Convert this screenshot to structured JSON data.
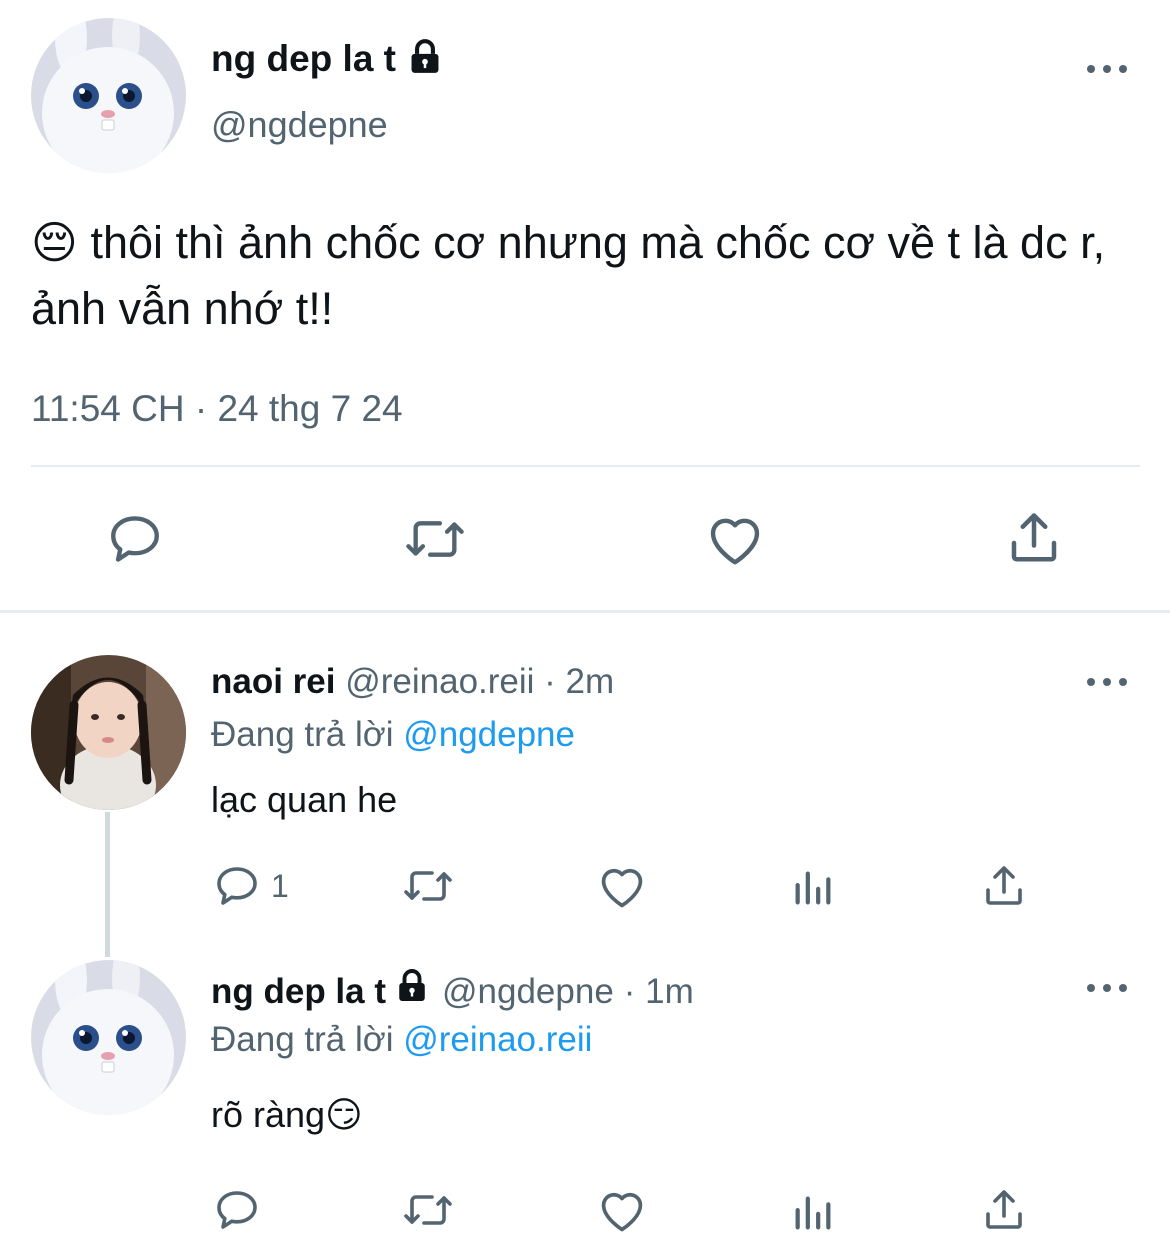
{
  "main_tweet": {
    "display_name": "ng dep la t",
    "handle": "@ngdepne",
    "emoji": "😔",
    "text": "thôi thì ảnh chốc cơ nhưng mà chốc cơ về t là dc r, ảnh vẫn nhớ t!!",
    "timestamp": "11:54 CH · 24 thg 7 24",
    "icons": [
      "reply-icon",
      "retweet-icon",
      "like-icon",
      "share-icon"
    ]
  },
  "replies": [
    {
      "display_name": "naoi rei",
      "handle": "@reinao.reii",
      "time": "· 2m",
      "replying_prefix": "Đang trả lời",
      "replying_to": "@ngdepne",
      "text": "lạc quan he",
      "reply_count": "1"
    },
    {
      "display_name": "ng dep la t",
      "handle": "@ngdepne",
      "time": "· 1m",
      "replying_prefix": "Đang trả lời",
      "replying_to": "@reinao.reii",
      "text": "rõ ràng",
      "emoji": "😏",
      "reply_count": ""
    }
  ],
  "colors": {
    "text": "#0f1419",
    "muted": "#536471",
    "link": "#1d9bf0",
    "divider": "#e6ecf0"
  }
}
